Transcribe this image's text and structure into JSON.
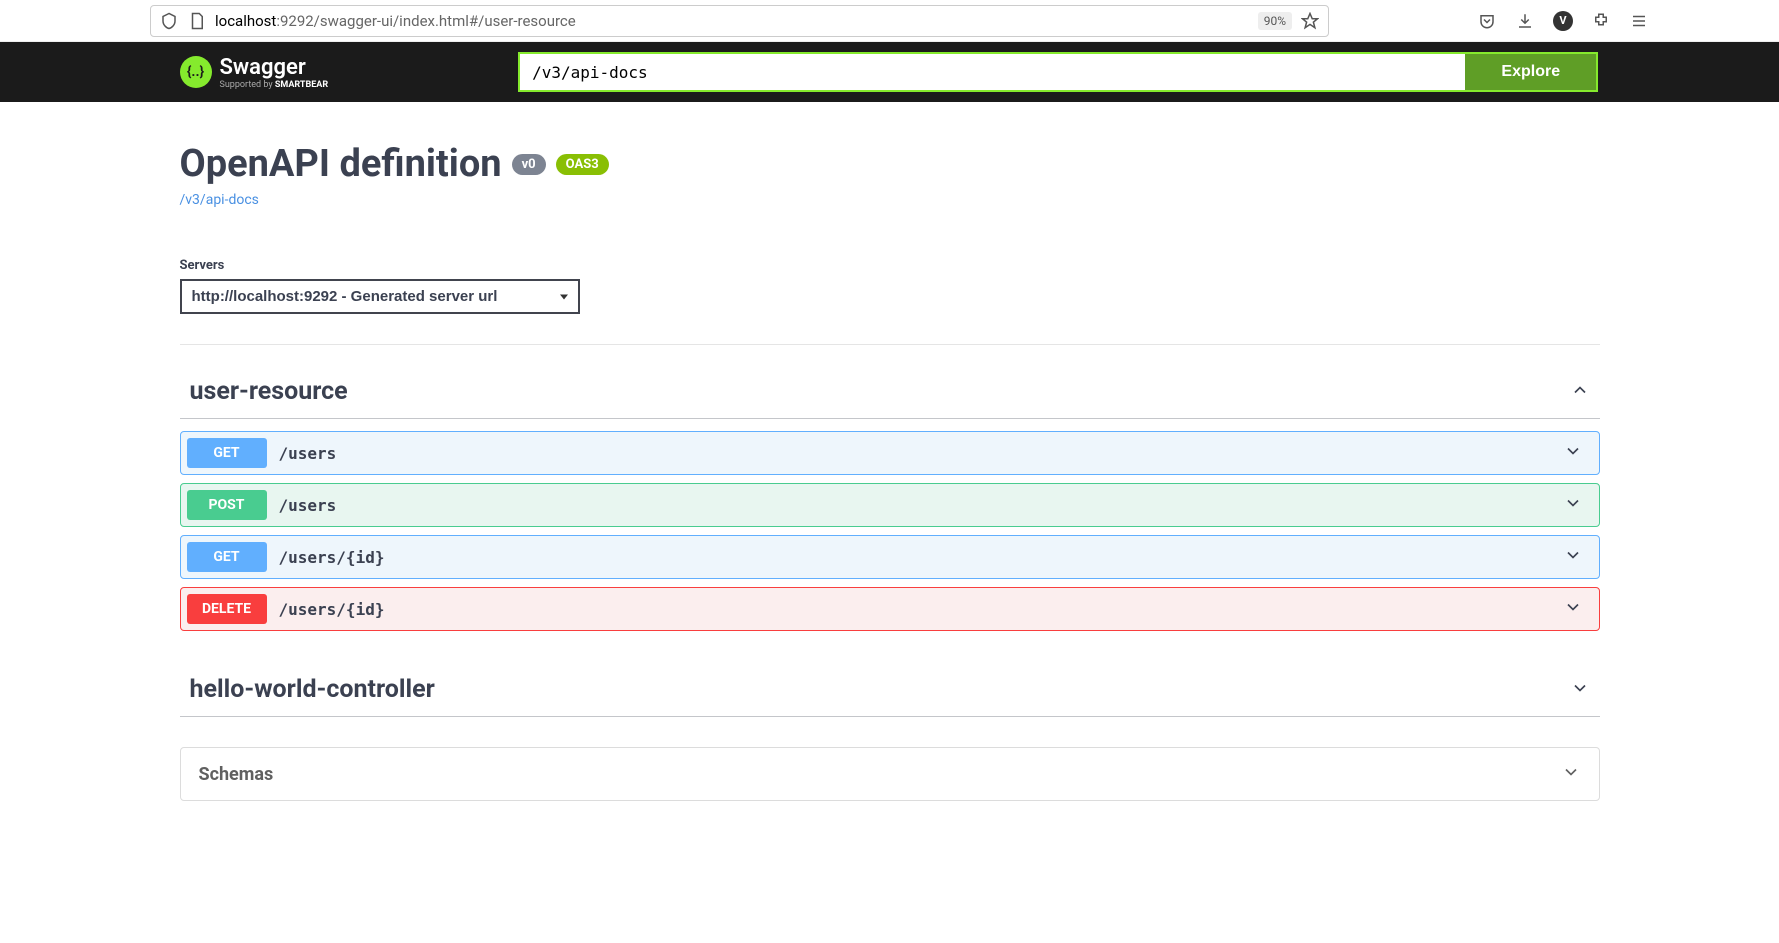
{
  "browser": {
    "url_domain": "localhost",
    "url_path": ":9292/swagger-ui/index.html#/user-resource",
    "zoom": "90%",
    "avatar_letter": "V"
  },
  "topbar": {
    "logo_text": "Swagger",
    "logo_sub_prefix": "Supported by ",
    "logo_sub_brand": "SMARTBEAR",
    "explore_input_value": "/v3/api-docs",
    "explore_button": "Explore"
  },
  "info": {
    "title": "OpenAPI definition",
    "version": "v0",
    "oas": "OAS3",
    "spec_link": "/v3/api-docs"
  },
  "servers": {
    "label": "Servers",
    "selected": "http://localhost:9292 - Generated server url"
  },
  "tags": [
    {
      "name": "user-resource",
      "expanded": true,
      "operations": [
        {
          "method": "GET",
          "path": "/users"
        },
        {
          "method": "POST",
          "path": "/users"
        },
        {
          "method": "GET",
          "path": "/users/{id}"
        },
        {
          "method": "DELETE",
          "path": "/users/{id}"
        }
      ]
    },
    {
      "name": "hello-world-controller",
      "expanded": false
    }
  ],
  "schemas": {
    "title": "Schemas"
  }
}
